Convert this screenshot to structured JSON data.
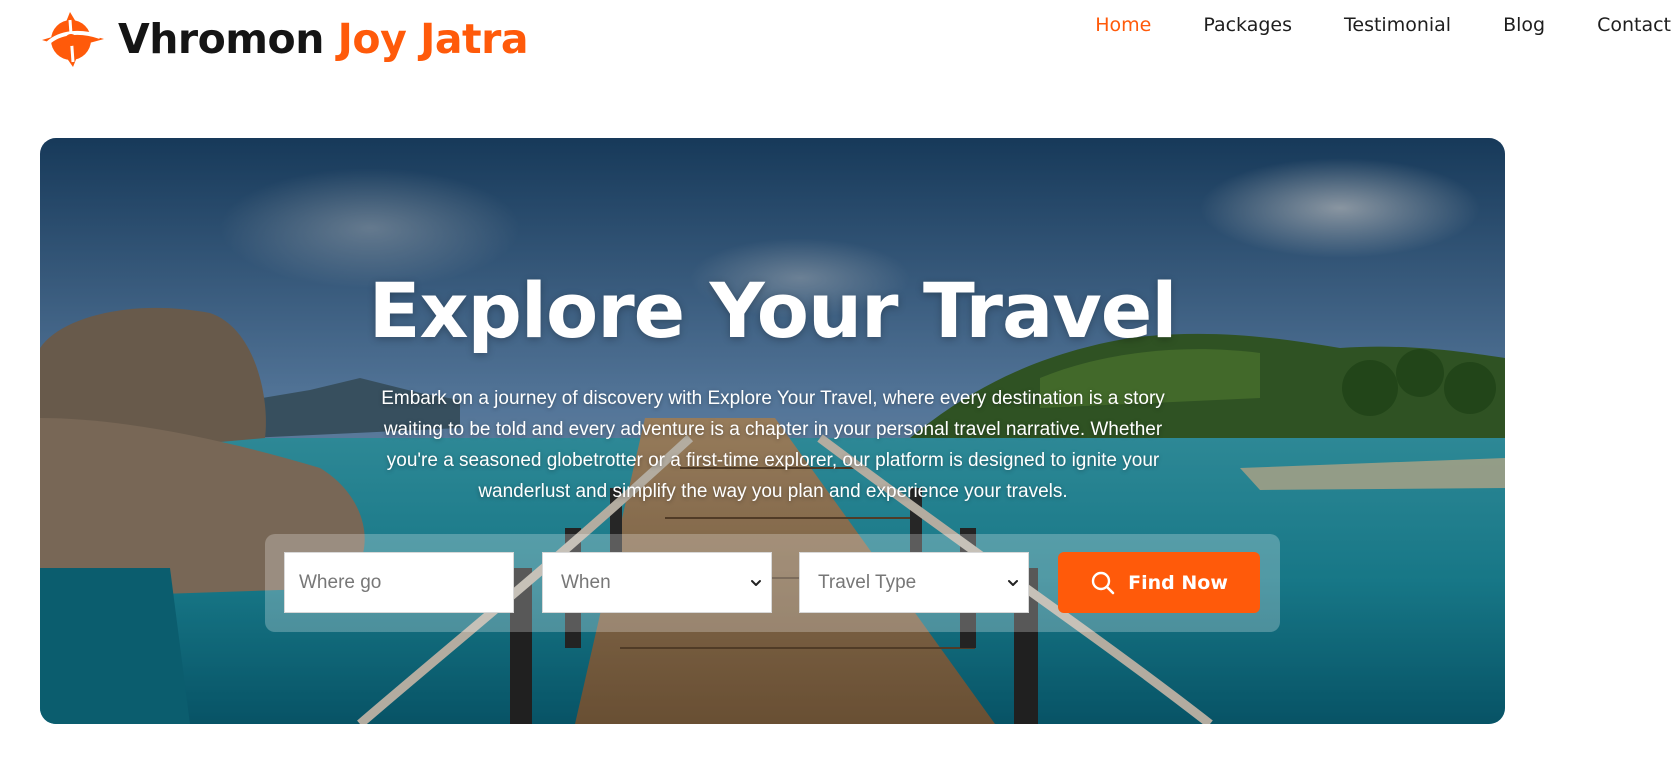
{
  "brand": {
    "name_primary": "Vhromon",
    "name_accent": "Joy Jatra",
    "accent_color": "#ff5a0a",
    "logo_icon": "compass-cross-logo-icon"
  },
  "nav": {
    "items": [
      {
        "label": "Home",
        "active": true
      },
      {
        "label": "Packages",
        "active": false
      },
      {
        "label": "Testimonial",
        "active": false
      },
      {
        "label": "Blog",
        "active": false
      },
      {
        "label": "Contact",
        "active": false
      }
    ]
  },
  "hero": {
    "title": "Explore Your Travel",
    "description": "Embark on a journey of discovery with Explore Your Travel, where every destination is a story waiting to be told and every adventure is a chapter in your personal travel narrative. Whether you're a seasoned globetrotter or a first-time explorer, our platform is designed to ignite your wanderlust and simplify the way you plan and experience your travels."
  },
  "search": {
    "where_placeholder": "Where go",
    "when_value": "When",
    "type_value": "Travel Type",
    "button_label": "Find Now",
    "button_icon": "search-icon",
    "button_color": "#ff5a0a"
  }
}
